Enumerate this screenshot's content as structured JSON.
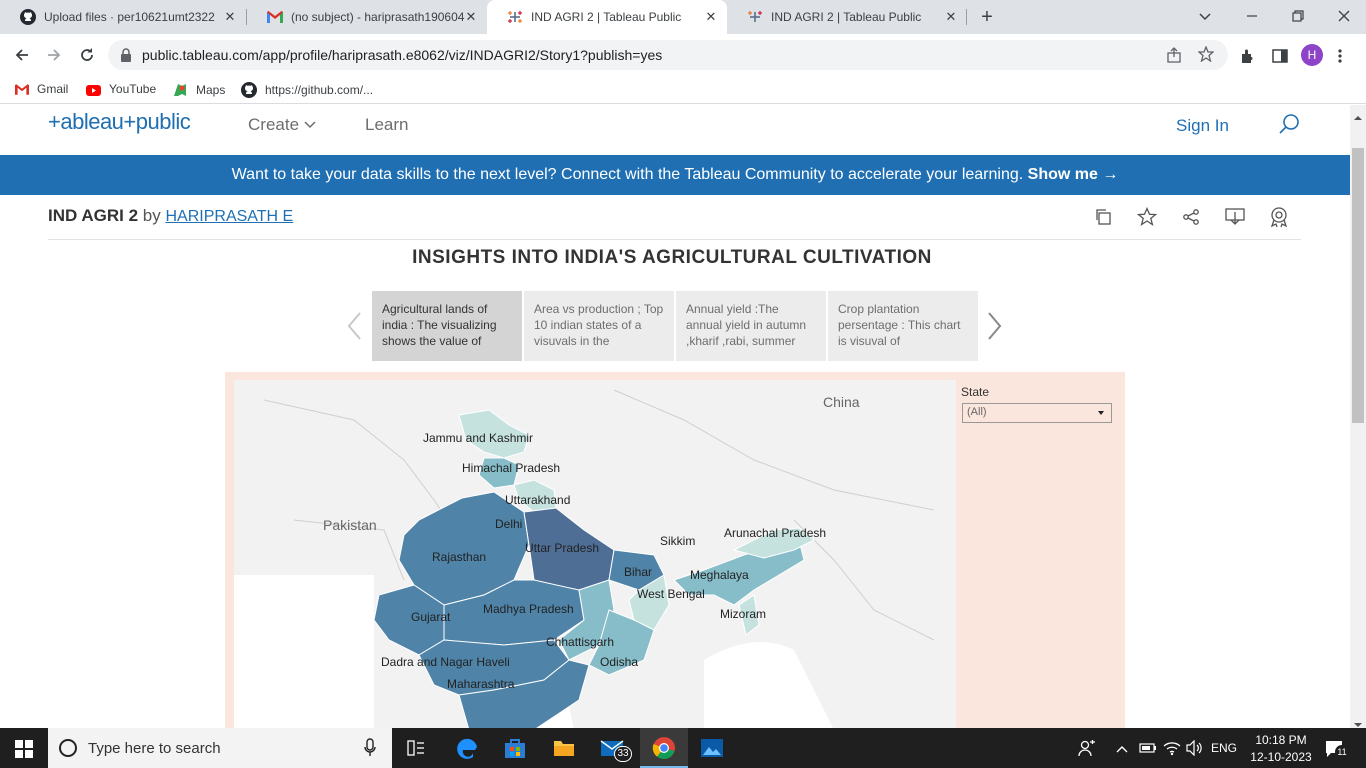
{
  "browser": {
    "tabs": [
      {
        "title": "Upload files · per10621umt2322",
        "icon": "github-icon"
      },
      {
        "title": "(no subject) - hariprasath190604",
        "icon": "gmail-icon"
      },
      {
        "title": "IND AGRI 2 | Tableau Public",
        "icon": "tableau-icon",
        "active": true
      },
      {
        "title": "IND AGRI 2 | Tableau Public",
        "icon": "tableau-icon"
      }
    ],
    "url": "public.tableau.com/app/profile/hariprasath.e8062/viz/INDAGRI2/Story1?publish=yes",
    "profile_initial": "H",
    "bookmarks": [
      "Gmail",
      "YouTube",
      "Maps",
      "https://github.com/..."
    ]
  },
  "site": {
    "logo": "+ableau+public",
    "nav": {
      "create": "Create",
      "learn": "Learn",
      "sign_in": "Sign In"
    },
    "promo_text": "Want to take your data skills to the next level? Connect with the Tableau Community to accelerate your learning.",
    "promo_link": "Show me →",
    "viz_title": "IND AGRI 2",
    "by_label": "by",
    "author": "HARIPRASATH E"
  },
  "story": {
    "title": "INSIGHTS INTO INDIA'S AGRICULTURAL CULTIVATION",
    "points": [
      {
        "text": "Agricultural lands of india : The visualizing shows  the value of",
        "active": true
      },
      {
        "text": "Area vs production ; Top 10 indian states of a visuvals in the"
      },
      {
        "text": "Annual yield :The annual yield in autumn ,kharif ,rabi, summer"
      },
      {
        "text": "Crop plantation persentage : This chart is visuval of"
      }
    ]
  },
  "map": {
    "filter_label": "State",
    "filter_value": "(All)",
    "country_labels": [
      "China",
      "Pakistan"
    ],
    "state_labels": [
      "Jammu and Kashmir",
      "Himachal Pradesh",
      "Uttarakhand",
      "Delhi",
      "Uttar Pradesh",
      "Rajasthan",
      "Bihar",
      "Sikkim",
      "Arunachal Pradesh",
      "Meghalaya",
      "West Bengal",
      "Mizoram",
      "Gujarat",
      "Madhya Pradesh",
      "Chhattisgarh",
      "Odisha",
      "Dadra and Nagar Haveli",
      "Maharashtra"
    ],
    "colors": {
      "dark": "#4e6e95",
      "mid": "#4f84a8",
      "light": "#86bdc9",
      "lightest": "#c6e2df"
    }
  },
  "taskbar": {
    "search_placeholder": "Type here to search",
    "mail_badge": "33",
    "language": "ENG",
    "time": "10:18 PM",
    "date": "12-10-2023",
    "notification_count": "11"
  }
}
